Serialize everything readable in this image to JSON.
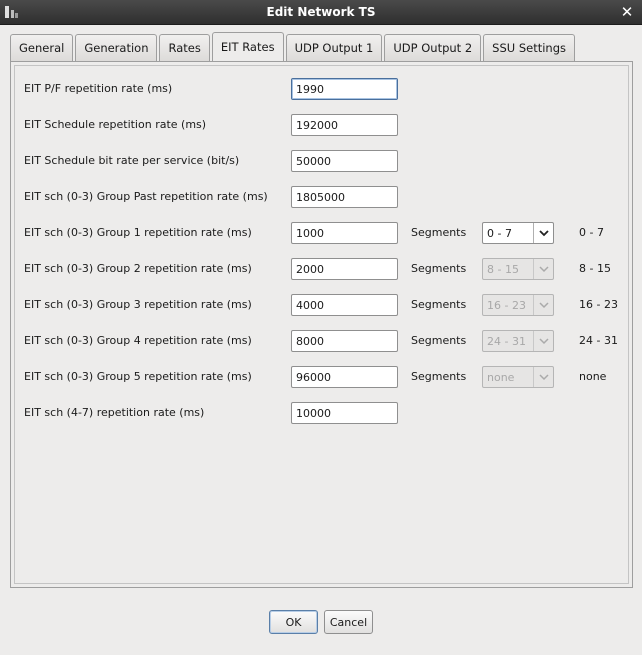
{
  "window": {
    "title": "Edit Network TS",
    "close_glyph": "✕"
  },
  "tabs": [
    {
      "label": "General",
      "active": false
    },
    {
      "label": "Generation",
      "active": false
    },
    {
      "label": "Rates",
      "active": false
    },
    {
      "label": "EIT Rates",
      "active": true
    },
    {
      "label": "UDP Output 1",
      "active": false
    },
    {
      "label": "UDP Output 2",
      "active": false
    },
    {
      "label": "SSU Settings",
      "active": false
    }
  ],
  "eit_rates": {
    "pf_rate": {
      "label": "EIT P/F repetition rate (ms)",
      "value": "1990"
    },
    "schedule_rate": {
      "label": "EIT Schedule repetition rate (ms)",
      "value": "192000"
    },
    "schedule_bitrate": {
      "label": "EIT Schedule bit rate per service (bit/s)",
      "value": "50000"
    },
    "group_past": {
      "label": "EIT sch (0-3) Group Past repetition rate (ms)",
      "value": "1805000"
    },
    "group1": {
      "label": "EIT sch (0-3) Group 1 repetition rate (ms)",
      "value": "1000",
      "segments_label": "Segments",
      "segments_value": "0 - 7",
      "range": "0 - 7",
      "enabled": true
    },
    "group2": {
      "label": "EIT sch (0-3) Group 2 repetition rate (ms)",
      "value": "2000",
      "segments_label": "Segments",
      "segments_value": "8 - 15",
      "range": "8 - 15",
      "enabled": false
    },
    "group3": {
      "label": "EIT sch (0-3) Group 3 repetition rate (ms)",
      "value": "4000",
      "segments_label": "Segments",
      "segments_value": "16 - 23",
      "range": "16 - 23",
      "enabled": false
    },
    "group4": {
      "label": "EIT sch (0-3) Group 4 repetition rate (ms)",
      "value": "8000",
      "segments_label": "Segments",
      "segments_value": "24 - 31",
      "range": "24 - 31",
      "enabled": false
    },
    "group5": {
      "label": "EIT sch (0-3) Group 5 repetition rate (ms)",
      "value": "96000",
      "segments_label": "Segments",
      "segments_value": "none",
      "range": "none",
      "enabled": false
    },
    "sch47_rate": {
      "label": "EIT sch (4-7) repetition rate (ms)",
      "value": "10000"
    }
  },
  "buttons": {
    "ok_label": "OK",
    "cancel_label": "Cancel"
  },
  "colors": {
    "title_bar": "#3a3a3a",
    "window_bg": "#edeceb",
    "focus_border": "#4a6f9c"
  }
}
